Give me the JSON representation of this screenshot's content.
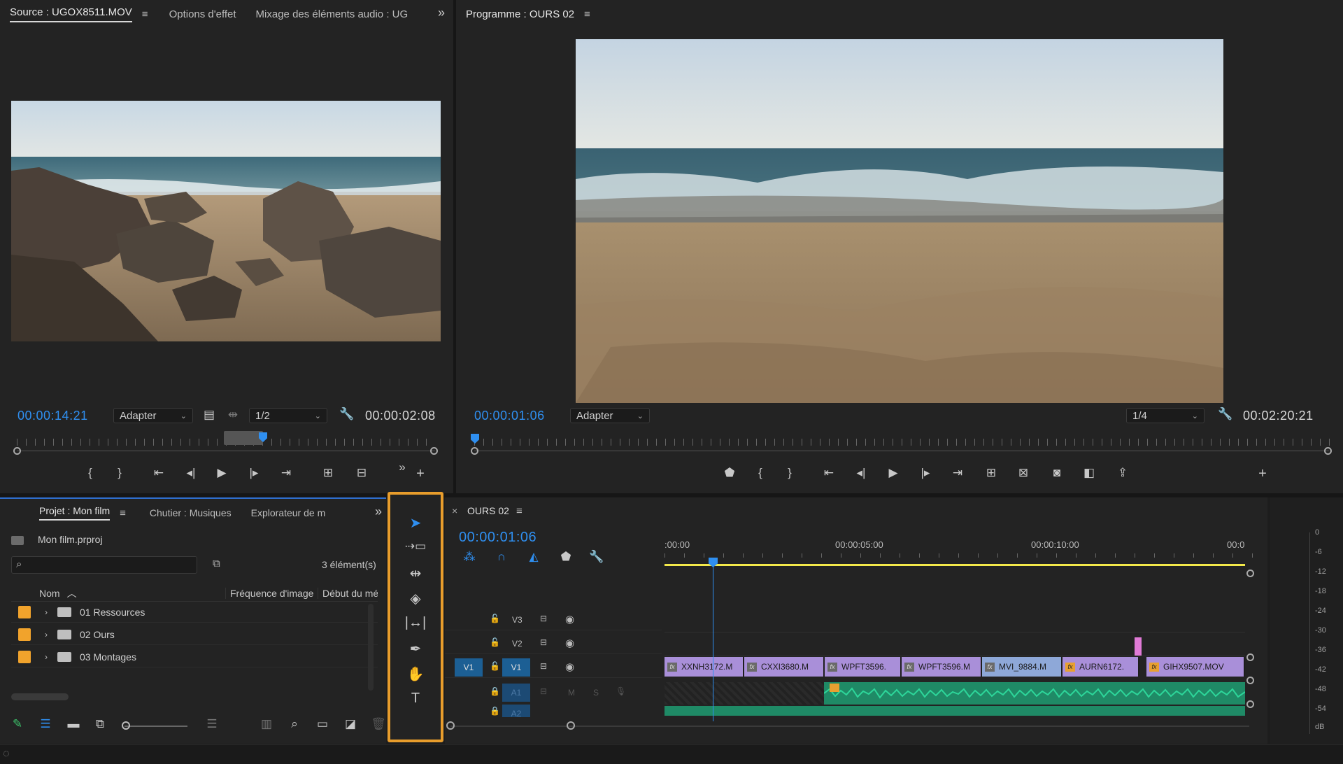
{
  "source_monitor": {
    "tabs": [
      "Source : UGOX8511.MOV",
      "Options d'effet",
      "Mixage des éléments audio : UG"
    ],
    "menu_glyph": "≡",
    "overflow": "»",
    "timecode_current": "00:00:14:21",
    "timecode_duration": "00:00:02:08",
    "fit_dropdown": "Adapter",
    "resolution_dropdown": "1/2",
    "controls": [
      "mark-in",
      "mark-out",
      "go-to-in",
      "step-back",
      "play",
      "step-forward",
      "go-to-out",
      "insert",
      "overwrite"
    ]
  },
  "program_monitor": {
    "title": "Programme : OURS 02",
    "menu_glyph": "≡",
    "timecode_current": "00:00:01:06",
    "timecode_duration": "00:02:20:21",
    "fit_dropdown": "Adapter",
    "resolution_dropdown": "1/4",
    "controls": [
      "add-marker",
      "mark-in",
      "mark-out",
      "go-to-in",
      "step-back",
      "play",
      "step-forward",
      "go-to-out",
      "lift",
      "extract",
      "export-frame",
      "comparison-view",
      "export"
    ]
  },
  "project_panel": {
    "tabs": [
      "Projet : Mon film",
      "Chutier : Musiques",
      "Explorateur de m"
    ],
    "project_file": "Mon film.prproj",
    "item_count": "3 élément(s)",
    "columns": [
      "Nom",
      "Fréquence d'image",
      "Début du mé"
    ],
    "items": [
      {
        "label": "01 Ressources",
        "color": "#f1a32c"
      },
      {
        "label": "02 Ours",
        "color": "#f1a32c"
      },
      {
        "label": "03 Montages",
        "color": "#f1a32c"
      }
    ]
  },
  "tools_panel": {
    "highlight_color": "#e89d2c",
    "tools": [
      "selection-tool",
      "track-select-tool",
      "ripple-edit-tool",
      "razor-tool",
      "slip-tool",
      "pen-tool",
      "hand-tool",
      "type-tool"
    ]
  },
  "timeline": {
    "sequence_name": "OURS 02",
    "close_glyph": "×",
    "menu_glyph": "≡",
    "timecode": "00:00:01:06",
    "ruler_labels": [
      ":00:00",
      "00:00:05:00",
      "00:00:10:00",
      "00:0"
    ],
    "tracks": {
      "video": [
        "V3",
        "V2",
        "V1"
      ],
      "source_patch": "V1",
      "audio": [
        "A1",
        "A2"
      ],
      "audio_buttons": [
        "M",
        "S"
      ]
    },
    "clips": [
      {
        "label": "XXNH3172.M",
        "fx": "fx",
        "color": "#a98fd9"
      },
      {
        "label": "CXXI3680.M",
        "fx": "fx",
        "color": "#a98fd9"
      },
      {
        "label": "WPFT3596.",
        "fx": "fx",
        "color": "#a98fd9"
      },
      {
        "label": "WPFT3596.M",
        "fx": "fx",
        "color": "#a98fd9"
      },
      {
        "label": "MVI_9884.M",
        "fx": "fx",
        "color": "#8ea8d8"
      },
      {
        "label": "AURN6172.",
        "fx": "fx",
        "color": "#a98fd9"
      },
      {
        "label": "GIHX9507.MOV",
        "fx": "fx",
        "color": "#a98fd9"
      }
    ],
    "playhead_color": "#2f8ff0",
    "workarea_color": "#f2e84a",
    "audio_color": "#2dbd8a"
  },
  "audio_meter": {
    "scale": [
      "0",
      "-6",
      "-12",
      "-18",
      "-24",
      "-30",
      "-36",
      "-42",
      "-48",
      "-54",
      "dB"
    ]
  }
}
